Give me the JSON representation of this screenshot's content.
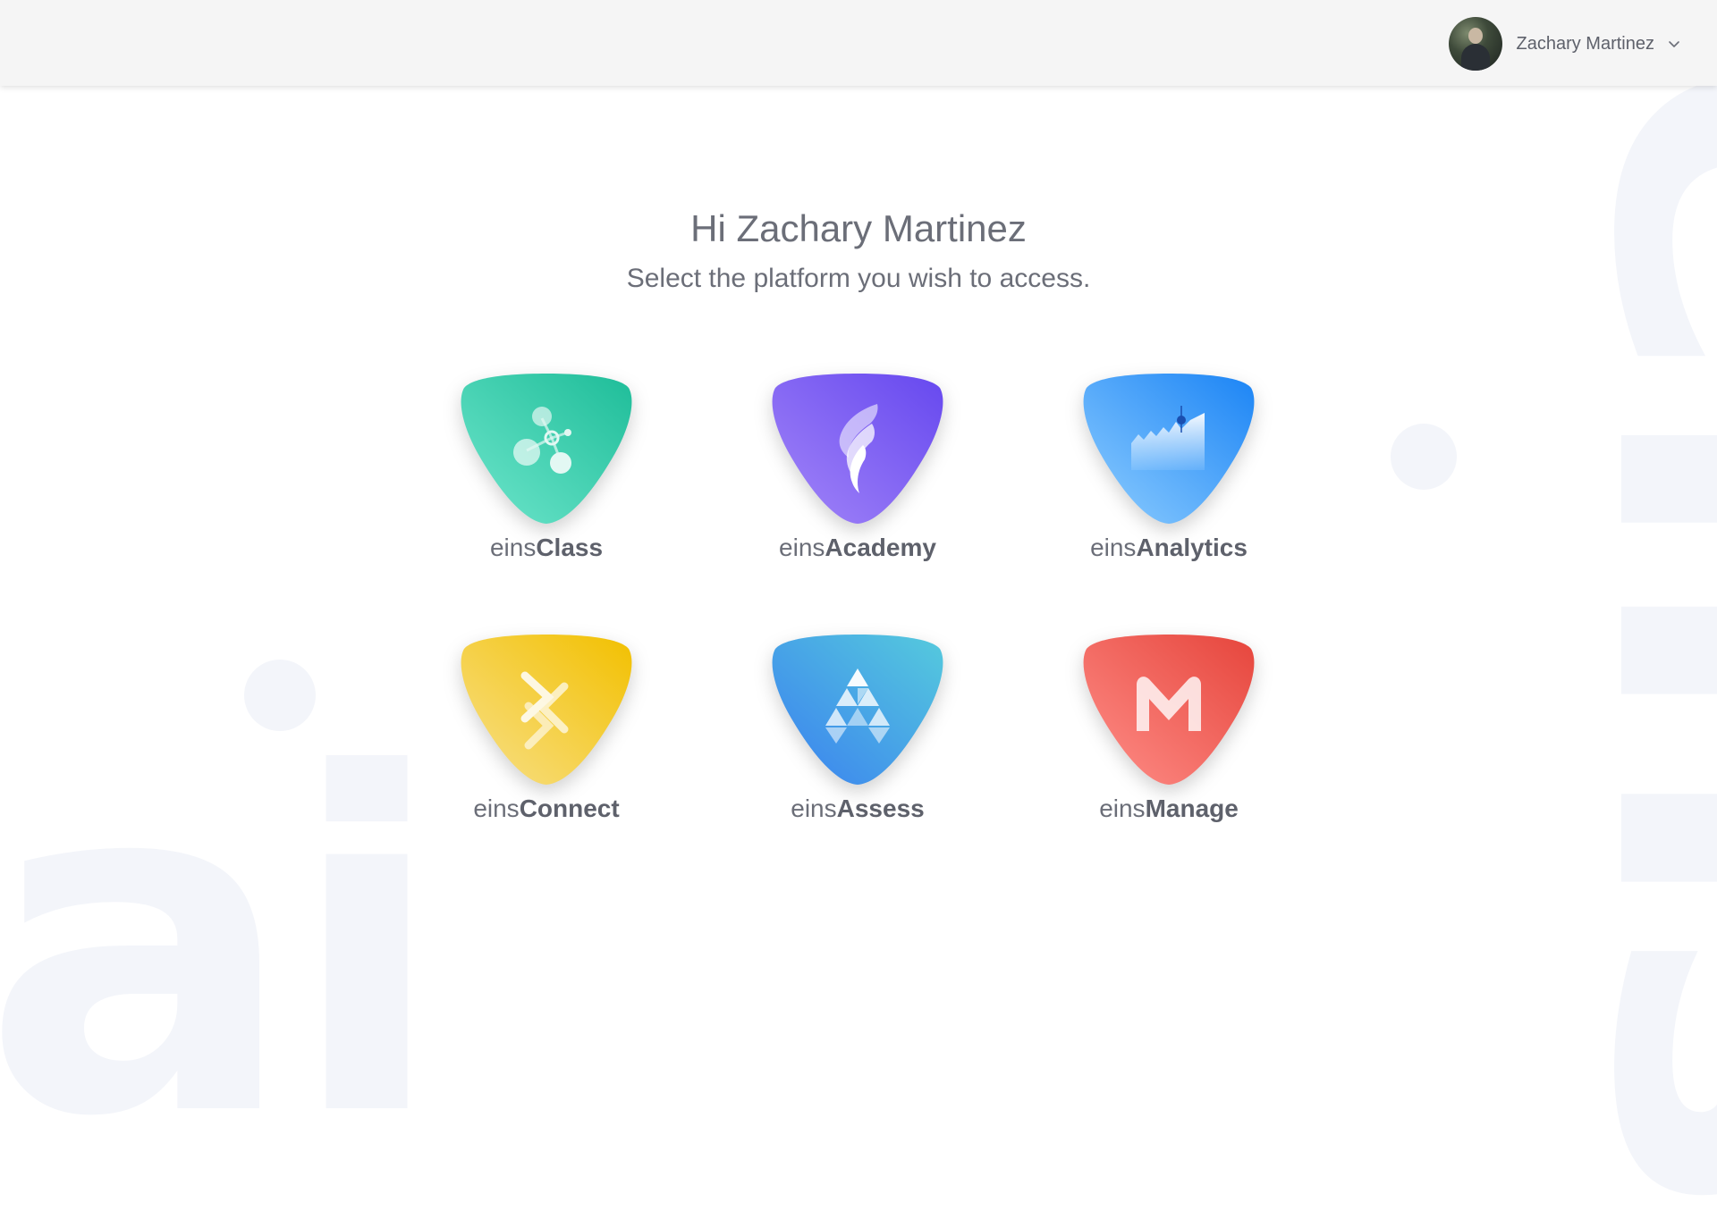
{
  "header": {
    "user_name": "Zachary Martinez"
  },
  "greeting": {
    "title": "Hi Zachary Martinez",
    "subtitle": "Select the platform you wish to access."
  },
  "platforms": [
    {
      "prefix": "eins",
      "name": "Class",
      "icon": "network-nodes-icon",
      "color_from": "#5fe3c5",
      "color_to": "#1fbf9b"
    },
    {
      "prefix": "eins",
      "name": "Academy",
      "icon": "flame-quill-icon",
      "color_from": "#9b7cf6",
      "color_to": "#6a4cf0"
    },
    {
      "prefix": "eins",
      "name": "Analytics",
      "icon": "area-chart-icon",
      "color_from": "#7cc4ff",
      "color_to": "#1f86f5"
    },
    {
      "prefix": "eins",
      "name": "Connect",
      "icon": "interlocking-arrows-icon",
      "color_from": "#f7dd7a",
      "color_to": "#f2c200"
    },
    {
      "prefix": "eins",
      "name": "Assess",
      "icon": "triangle-pyramid-icon",
      "color_from": "#3d82f0",
      "color_to": "#52c8de"
    },
    {
      "prefix": "eins",
      "name": "Manage",
      "icon": "letter-m-icon",
      "color_from": "#ff8a84",
      "color_to": "#e8473f"
    }
  ],
  "background": {
    "watermark_left": "ai",
    "watermark_right": "eins"
  }
}
